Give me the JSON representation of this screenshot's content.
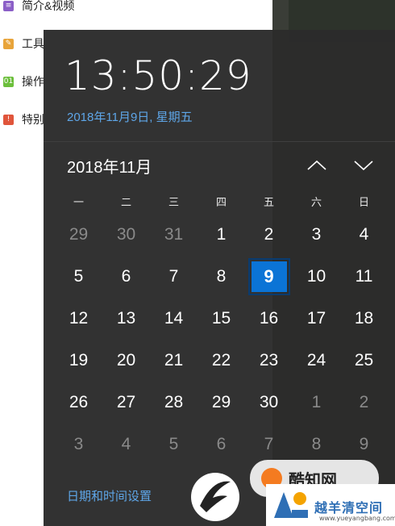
{
  "background_app": {
    "items": [
      {
        "icon": "list-icon",
        "label": "简介&视频",
        "color": "#8b5fc7",
        "glyph": "≡"
      },
      {
        "icon": "wrench-icon",
        "label": "工具",
        "color": "#e8a43a",
        "glyph": "✎"
      },
      {
        "icon": "step-icon",
        "label": "操作",
        "color": "#6cbf3c",
        "glyph": "01"
      },
      {
        "icon": "alert-icon",
        "label": "特别",
        "color": "#e0553b",
        "glyph": "!"
      }
    ]
  },
  "clock": {
    "time": "13:50:29",
    "date_link": "2018年11月9日, 星期五"
  },
  "calendar": {
    "month_label": "2018年11月",
    "nav_up_icon": "chevron-up-icon",
    "nav_down_icon": "chevron-down-icon",
    "weekdays": [
      "一",
      "二",
      "三",
      "四",
      "五",
      "六",
      "日"
    ],
    "weeks": [
      [
        {
          "d": "29",
          "dim": true
        },
        {
          "d": "30",
          "dim": true
        },
        {
          "d": "31",
          "dim": true
        },
        {
          "d": "1"
        },
        {
          "d": "2"
        },
        {
          "d": "3"
        },
        {
          "d": "4"
        }
      ],
      [
        {
          "d": "5"
        },
        {
          "d": "6"
        },
        {
          "d": "7"
        },
        {
          "d": "8"
        },
        {
          "d": "9",
          "today": true
        },
        {
          "d": "10"
        },
        {
          "d": "11"
        }
      ],
      [
        {
          "d": "12"
        },
        {
          "d": "13"
        },
        {
          "d": "14"
        },
        {
          "d": "15"
        },
        {
          "d": "16"
        },
        {
          "d": "17"
        },
        {
          "d": "18"
        }
      ],
      [
        {
          "d": "19"
        },
        {
          "d": "20"
        },
        {
          "d": "21"
        },
        {
          "d": "22"
        },
        {
          "d": "23"
        },
        {
          "d": "24"
        },
        {
          "d": "25"
        }
      ],
      [
        {
          "d": "26"
        },
        {
          "d": "27"
        },
        {
          "d": "28"
        },
        {
          "d": "29"
        },
        {
          "d": "30"
        },
        {
          "d": "1",
          "dim": true
        },
        {
          "d": "2",
          "dim": true
        }
      ],
      [
        {
          "d": "3",
          "dim": true
        },
        {
          "d": "4",
          "dim": true
        },
        {
          "d": "5",
          "dim": true
        },
        {
          "d": "6",
          "dim": true
        },
        {
          "d": "7",
          "dim": true
        },
        {
          "d": "8",
          "dim": true
        },
        {
          "d": "9",
          "dim": true
        }
      ]
    ],
    "accent": "#0b74d6"
  },
  "settings_link": "日期和时间设置",
  "watermarks": {
    "brand_text": "酷知网",
    "site_text": "越羊清空间",
    "site_url": "www.yueyangbang.com"
  }
}
